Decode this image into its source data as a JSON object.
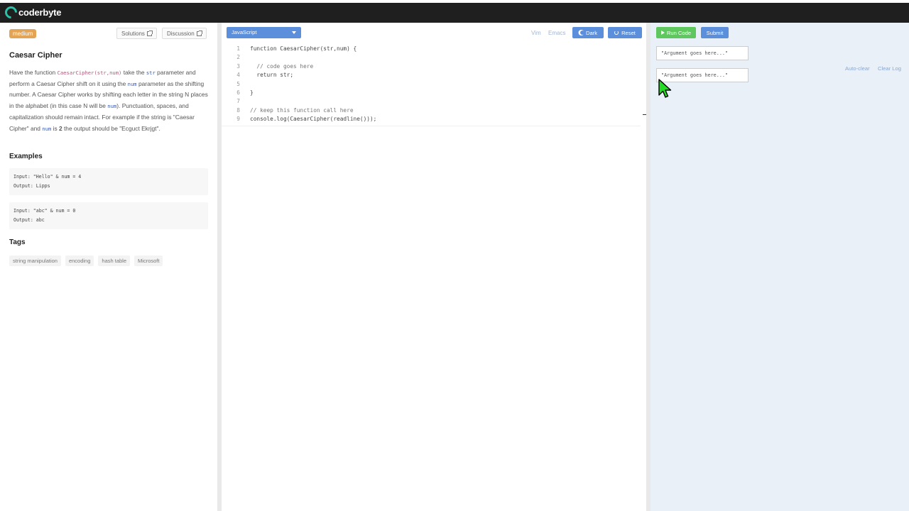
{
  "topbar": {
    "logo_text": "coderbyte"
  },
  "problem": {
    "difficulty": "medium",
    "solutions_label": "Solutions",
    "discussion_label": "Discussion",
    "title": "Caesar Cipher",
    "desc": {
      "t1": "Have the function ",
      "c1": "CaesarCipher(str,num)",
      "t2": " take the ",
      "c2": "str",
      "t3": " parameter and perform a Caesar Cipher shift on it using the ",
      "c3": "num",
      "t4": " parameter as the shifting number. A Caesar Cipher works by shifting each letter in the string N places in the alphabet (in this case N will be ",
      "c4": "num",
      "t5": "). Punctuation, spaces, and capitalization should remain intact. For example if the string is \"Caesar Cipher\" and ",
      "c5": "num",
      "t6": " is ",
      "b1": "2",
      "t7": " the output should be \"Ecguct Ekrjgt\"."
    },
    "examples_heading": "Examples",
    "examples": [
      {
        "input": "Input: \"Hello\" & num = 4",
        "output": "Output: Lipps"
      },
      {
        "input": "Input: \"abc\" & num = 0",
        "output": "Output: abc"
      }
    ],
    "tags_heading": "Tags",
    "tags": [
      "string manipulation",
      "encoding",
      "hash table",
      "Microsoft"
    ]
  },
  "editor": {
    "language": "JavaScript",
    "vim_label": "Vim",
    "emacs_label": "Emacs",
    "dark_label": "Dark",
    "reset_label": "Reset",
    "lines": [
      {
        "n": "1",
        "text": "function CaesarCipher(str,num) {"
      },
      {
        "n": "2",
        "text": ""
      },
      {
        "n": "3",
        "text": "  // code goes here"
      },
      {
        "n": "4",
        "text": "  return str;"
      },
      {
        "n": "5",
        "text": ""
      },
      {
        "n": "6",
        "text": "}"
      },
      {
        "n": "7",
        "text": ""
      },
      {
        "n": "8",
        "text": "// keep this function call here"
      },
      {
        "n": "9",
        "text": "console.log(CaesarCipher(readline()));"
      }
    ]
  },
  "runner": {
    "run_label": "Run Code",
    "submit_label": "Submit",
    "arg_placeholder_1": "\"Argument goes here...\"",
    "arg_placeholder_2": "\"Argument goes here...\"",
    "auto_clear_label": "Auto-clear",
    "clear_log_label": "Clear Log"
  },
  "colors": {
    "topbar": "#1f1f1f",
    "accent_blue": "#5b8fdc",
    "run_green": "#5ec85e",
    "difficulty_orange": "#e3a455",
    "logo_teal": "#27c3a8",
    "pointer_green": "#22dd22"
  }
}
